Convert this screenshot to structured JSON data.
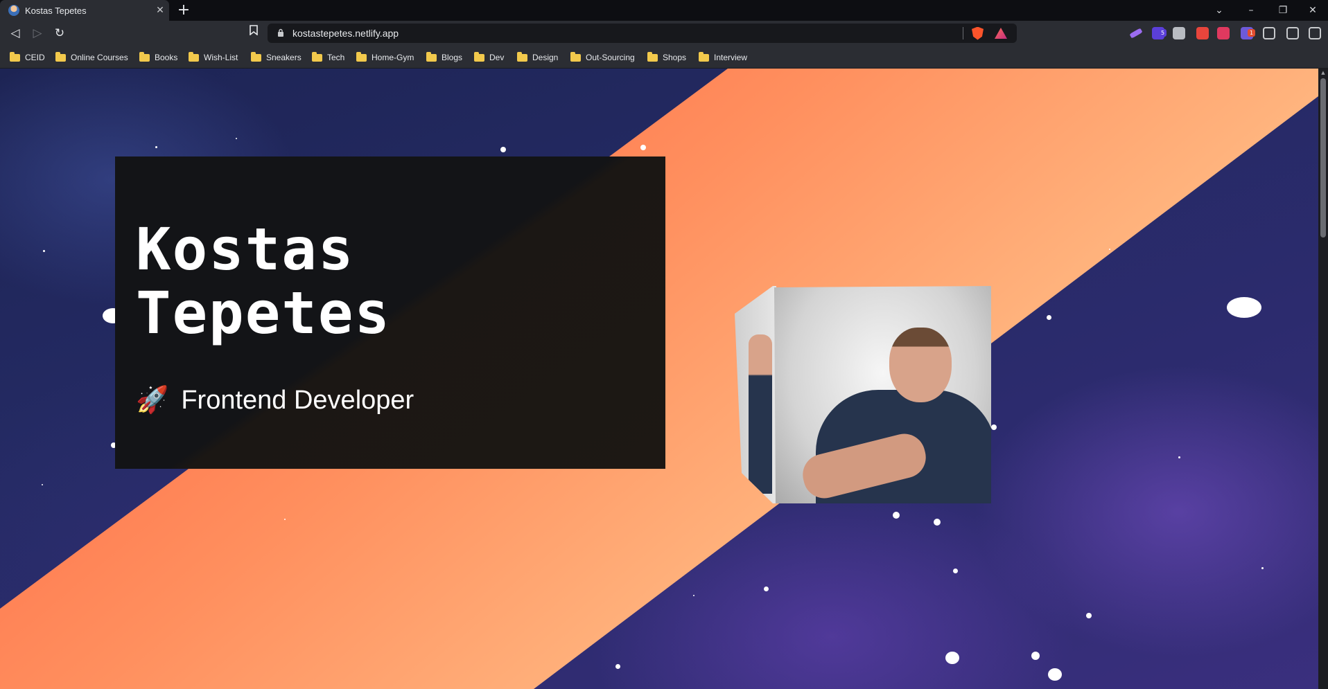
{
  "browser": {
    "tab": {
      "title": "Kostas Tepetes",
      "close": "✕",
      "new_tab": "+"
    },
    "window_controls": {
      "tab_search": "⌄",
      "minimize": "–",
      "restore": "❐",
      "close": "✕"
    },
    "nav": {
      "back": "◁",
      "forward": "▷",
      "reload": "↻",
      "bookmark": "🔖"
    },
    "url": "kostastepetes.netlify.app",
    "extensions": [
      {
        "name": "pen-extension-icon",
        "color": "#9b6cf0"
      },
      {
        "name": "crypto-extension-icon",
        "color": "#5b3fd9",
        "badge": "5",
        "badge_color": "#5b3fd9"
      },
      {
        "name": "camera-extension-icon",
        "color": "#b9bcc2"
      },
      {
        "name": "chrome-color-extension-icon",
        "color": "#e8453c"
      },
      {
        "name": "pin-extension-icon",
        "color": "#e0395f"
      },
      {
        "name": "gear-extension-icon",
        "color": "#6d5ad8",
        "badge": "1",
        "badge_color": "#e34d2f"
      },
      {
        "name": "puzzle-extensions-icon",
        "color": "#c8cacd"
      },
      {
        "name": "wallet-icon",
        "color": "#c8cacd"
      },
      {
        "name": "menu-icon",
        "color": "#c8cacd"
      }
    ],
    "bookmarks": [
      "CEID",
      "Online Courses",
      "Books",
      "Wish-List",
      "Sneakers",
      "Tech",
      "Home-Gym",
      "Blogs",
      "Dev",
      "Design",
      "Out-Sourcing",
      "Shops",
      "Interview"
    ]
  },
  "hero": {
    "name_line1": "Kostas",
    "name_line2": "Tepetes",
    "role_icon": "🚀",
    "role": "Frontend Developer"
  },
  "colors": {
    "space_bg": "#242a63",
    "beam": "#ff8f5e",
    "card": "#131417"
  }
}
